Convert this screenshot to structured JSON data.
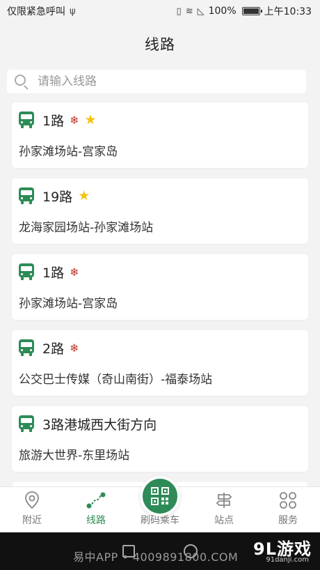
{
  "status_bar": {
    "carrier": "仅限紧急呼叫",
    "usb_icon": "usb-icon",
    "battery_percent": "100%",
    "time": "上午10:33"
  },
  "header": {
    "title": "线路"
  },
  "search": {
    "placeholder": "请输入线路",
    "value": ""
  },
  "routes": [
    {
      "name": "1路",
      "favorite": true,
      "snow": true,
      "stops": "孙家滩场站-宫家岛"
    },
    {
      "name": "19路",
      "favorite": true,
      "snow": false,
      "stops": "龙海家园场站-孙家滩场站"
    },
    {
      "name": "1路",
      "favorite": false,
      "snow": true,
      "stops": "孙家滩场站-宫家岛"
    },
    {
      "name": "2路",
      "favorite": false,
      "snow": true,
      "stops": "公交巴士传媒（奇山南街）-福泰场站"
    },
    {
      "name": "3路港城西大街方向",
      "favorite": false,
      "snow": false,
      "stops": "旅游大世界-东里场站"
    }
  ],
  "tabs": [
    {
      "label": "附近",
      "icon": "location-pin-icon",
      "active": false
    },
    {
      "label": "线路",
      "icon": "route-icon",
      "active": true
    },
    {
      "label": "刷码乘车",
      "icon": "qr-code-icon",
      "active": false
    },
    {
      "label": "站点",
      "icon": "signpost-icon",
      "active": false
    },
    {
      "label": "服务",
      "icon": "grid-flower-icon",
      "active": false
    }
  ],
  "footer": {
    "watermark": "易中APP • 4009891800.COM",
    "brand": "9L游戏",
    "brand_site": "91danji.com"
  },
  "colors": {
    "accent": "#2e8b57",
    "star": "#f4c20d",
    "snow": "#c0392b"
  }
}
